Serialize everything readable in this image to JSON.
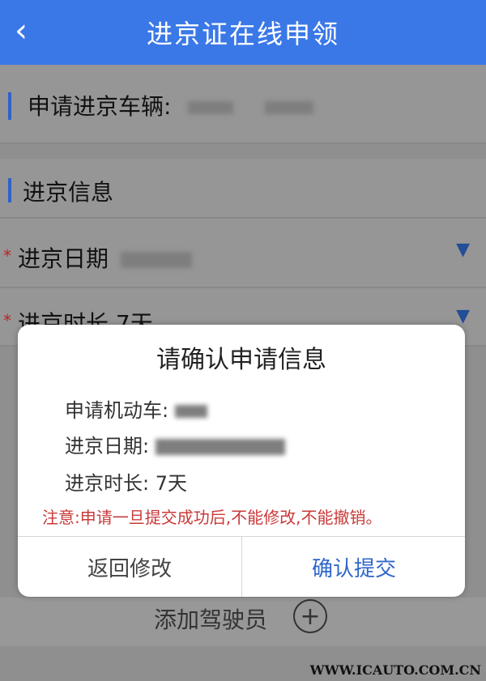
{
  "header": {
    "back_icon": "chevron-left-icon",
    "title": "进京证在线申领"
  },
  "vehicle_row": {
    "label": "申请进京车辆:"
  },
  "section": {
    "title": "进京信息"
  },
  "form": {
    "required_mark": "*",
    "date_label": "进京日期",
    "duration_label": "进京时长",
    "duration_value": "7天",
    "dropdown_icon": "triangle-down-icon"
  },
  "dialog": {
    "title": "请确认申请信息",
    "vehicle_label": "申请机动车:",
    "date_label": "进京日期:",
    "duration_label": "进京时长:",
    "duration_value": "7天",
    "warning": "注意:申请一旦提交成功后,不能修改,不能撤销。",
    "left_button": "返回修改",
    "right_button": "确认提交"
  },
  "footer": {
    "add_driver_label": "添加驾驶员",
    "add_icon": "plus-circle-icon",
    "watermark": "WWW.ICAUTO.COM.CN"
  },
  "colors": {
    "header_bg": "#3b78e7",
    "primary_text": "#2f66c9",
    "warning_text": "#c93a3a",
    "overlay_bg": "#8f8f8f"
  }
}
